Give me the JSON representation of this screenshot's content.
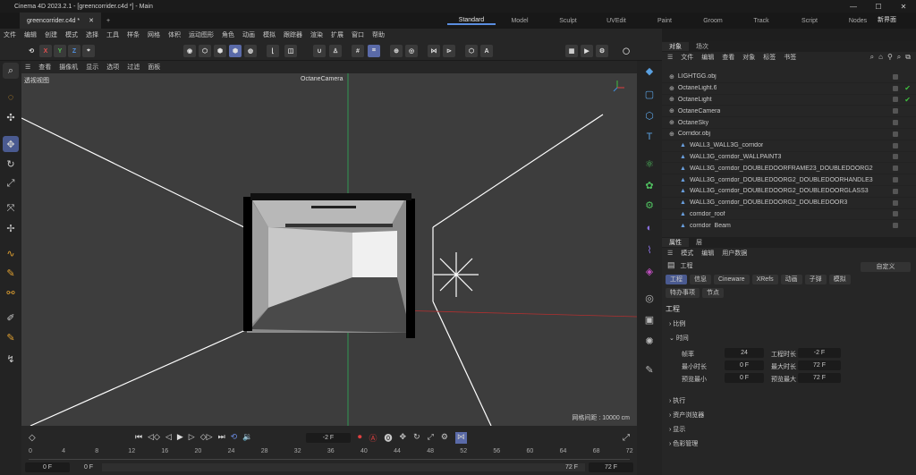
{
  "app": {
    "title": "Cinema 4D 2023.2.1 - [greencorrider.c4d *] - Main",
    "doc_tab": "greencorrider.c4d *",
    "new_ui": "新界面"
  },
  "layouts": [
    "Standard",
    "Model",
    "Sculpt",
    "UVEdit",
    "Paint",
    "Groom",
    "Track",
    "Script",
    "Nodes"
  ],
  "menu": [
    "文件",
    "编辑",
    "创建",
    "模式",
    "选择",
    "工具",
    "样条",
    "网格",
    "体积",
    "运动图形",
    "角色",
    "动画",
    "模拟",
    "跟踪器",
    "渲染",
    "扩展",
    "窗口",
    "帮助"
  ],
  "axes": {
    "x": "X",
    "y": "Y",
    "z": "Z"
  },
  "viewport": {
    "menu": [
      "查看",
      "摄像机",
      "显示",
      "选项",
      "过滤",
      "面板"
    ],
    "label": "透视视图",
    "camera": "OctaneCamera",
    "grid": "网格间距 : 10000 cm"
  },
  "timeline": {
    "frame": "-2 F",
    "start": "0 F",
    "start2": "0 F",
    "end": "72 F",
    "end2": "72 F",
    "ticks": [
      "0",
      "4",
      "8",
      "12",
      "16",
      "20",
      "24",
      "28",
      "32",
      "36",
      "40",
      "44",
      "48",
      "52",
      "56",
      "60",
      "64",
      "68",
      "72"
    ]
  },
  "objects": {
    "tabs": [
      "对象",
      "场次"
    ],
    "menu": [
      "文件",
      "编辑",
      "查看",
      "对象",
      "标签",
      "书签"
    ],
    "items": [
      {
        "name": "LIGHTGG.obj",
        "indent": 0,
        "check": false
      },
      {
        "name": "OctaneLight.6",
        "indent": 0,
        "check": true
      },
      {
        "name": "OctaneLight",
        "indent": 0,
        "check": true
      },
      {
        "name": "OctaneCamera",
        "indent": 0,
        "check": false
      },
      {
        "name": "OctaneSky",
        "indent": 0,
        "check": false
      },
      {
        "name": "Corridor.obj",
        "indent": 0,
        "check": false
      },
      {
        "name": "WALL3_WALL3G_corridor",
        "indent": 1,
        "check": false
      },
      {
        "name": "WALL3G_corridor_WALLPAINT3",
        "indent": 1,
        "check": false
      },
      {
        "name": "WALL3G_corridor_DOUBLEDOORFRAME23_DOUBLEDOORG2",
        "indent": 1,
        "check": false
      },
      {
        "name": "WALL3G_corridor_DOUBLEDOORG2_DOUBLEDOORHANDLE3",
        "indent": 1,
        "check": false
      },
      {
        "name": "WALL3G_corridor_DOUBLEDOORG2_DOUBLEDOORGLASS3",
        "indent": 1,
        "check": false
      },
      {
        "name": "WALL3G_corridor_DOUBLEDOORG2_DOUBLEDOOR3",
        "indent": 1,
        "check": false
      },
      {
        "name": "corridor_roof",
        "indent": 1,
        "check": false
      },
      {
        "name": "corridor_Beam",
        "indent": 1,
        "check": false
      }
    ]
  },
  "attributes": {
    "tabs": [
      "属性",
      "层"
    ],
    "menu": [
      "模式",
      "编辑",
      "用户数据"
    ],
    "object": "工程",
    "preset": "自定义",
    "buttons": [
      "工程",
      "信息",
      "Cineware",
      "XRefs",
      "动画",
      "子弹",
      "模拟"
    ],
    "buttons2": [
      "特办事项",
      "节点"
    ],
    "section": "工程",
    "groups": [
      "比例",
      "时间"
    ],
    "groups2": [
      "执行",
      "资产浏览器",
      "显示",
      "色彩管理"
    ],
    "fields": [
      {
        "label": "帧率",
        "value": "24",
        "label2": "工程时长",
        "value2": "-2 F"
      },
      {
        "label": "最小时长",
        "value": "0 F",
        "label2": "最大时长",
        "value2": "72 F"
      },
      {
        "label": "预览最小",
        "value": "0 F",
        "label2": "预览最大",
        "value2": "72 F"
      }
    ]
  },
  "colors": {
    "accent": "#5a8de0",
    "green": "#3fbf3f",
    "x_axis": "#e04040",
    "y_axis": "#40c040",
    "z_axis": "#4090e0"
  }
}
